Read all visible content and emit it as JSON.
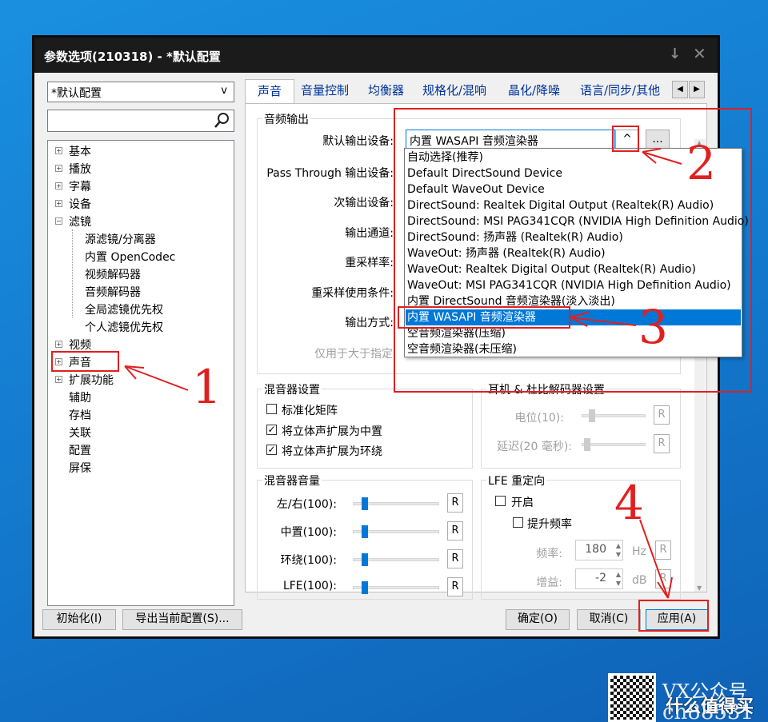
{
  "window": {
    "title": "参数选项(210318) - *默认配置"
  },
  "profile": {
    "selected": "*默认配置",
    "search_placeholder": ""
  },
  "tree": [
    {
      "label": "基本",
      "expand": "+"
    },
    {
      "label": "播放",
      "expand": "+"
    },
    {
      "label": "字幕",
      "expand": "+"
    },
    {
      "label": "设备",
      "expand": "+"
    },
    {
      "label": "滤镜",
      "expand": "−"
    },
    {
      "label": "源滤镜/分离器"
    },
    {
      "label": "内置 OpenCodec"
    },
    {
      "label": "视频解码器"
    },
    {
      "label": "音频解码器"
    },
    {
      "label": "全局滤镜优先权"
    },
    {
      "label": "个人滤镜优先权"
    },
    {
      "label": "视频",
      "expand": "+"
    },
    {
      "label": "声音",
      "expand": "+"
    },
    {
      "label": "扩展功能",
      "expand": "+"
    },
    {
      "label": "辅助"
    },
    {
      "label": "存档"
    },
    {
      "label": "关联"
    },
    {
      "label": "配置"
    },
    {
      "label": "屏保"
    }
  ],
  "tabs": [
    "声音",
    "音量控制",
    "均衡器",
    "规格化/混响",
    "晶化/降噪",
    "语言/同步/其他"
  ],
  "audio_output": {
    "group_title": "音频输出",
    "default_device_label": "默认输出设备:",
    "default_device_value": "内置 WASAPI 音频渲染器",
    "passthrough_label": "Pass Through 输出设备:",
    "secondary_label": "次输出设备:",
    "channels_label": "输出通道:",
    "resample_label": "重采样率:",
    "resample_cond_label": "重采样使用条件:",
    "output_mode_label": "输出方式:",
    "only_for_label": "仅用于大于指定",
    "ellipsis_button": "...",
    "combo_arrow": "^"
  },
  "dropdown_options": [
    "自动选择(推荐)",
    "Default DirectSound Device",
    "Default WaveOut Device",
    "DirectSound: Realtek Digital Output (Realtek(R) Audio)",
    "DirectSound: MSI PAG341CQR (NVIDIA High Definition Audio)",
    "DirectSound: 扬声器 (Realtek(R) Audio)",
    "WaveOut: 扬声器 (Realtek(R) Audio)",
    "WaveOut: Realtek Digital Output (Realtek(R) Audio)",
    "WaveOut: MSI PAG341CQR (NVIDIA High Definition Audio)",
    "内置 DirectSound 音频渲染器(淡入淡出)",
    "内置 WASAPI 音频渲染器",
    "空音频渲染器(压缩)",
    "空音频渲染器(未压缩)"
  ],
  "dropdown_selected_index": 10,
  "mixer": {
    "group_title": "混音器设置",
    "standard_matrix": "标准化矩阵",
    "standard_matrix_checked": false,
    "expand_center": "将立体声扩展为中置",
    "expand_center_checked": true,
    "expand_surround": "将立体声扩展为环绕",
    "expand_surround_checked": true
  },
  "headphone": {
    "group_title": "耳机 & 杜比解码器设置",
    "level_label": "电位(10):",
    "delay_label": "延迟(20 毫秒):",
    "r": "R"
  },
  "mixer_volume": {
    "group_title": "混音器音量",
    "rows": [
      {
        "label": "左/右(100):",
        "level": 0.1
      },
      {
        "label": "中置(100):",
        "level": 0.1
      },
      {
        "label": "环绕(100):",
        "level": 0.1
      },
      {
        "label": "LFE(100):",
        "level": 0.1
      }
    ],
    "r": "R"
  },
  "lfe": {
    "group_title": "LFE 重定向",
    "enable": "开启",
    "enable_checked": false,
    "boost": "提升频率",
    "boost_checked": false,
    "freq_label": "频率:",
    "freq_value": "180",
    "freq_unit": "Hz",
    "gain_label": "增益:",
    "gain_value": "-2",
    "gain_unit": "dB",
    "r": "R"
  },
  "buttons": {
    "init": "初始化(I)",
    "export": "导出当前配置(S)...",
    "ok": "确定(O)",
    "cancel": "取消(C)",
    "apply": "应用(A)"
  },
  "annotations": [
    "1",
    "2",
    "3",
    "4"
  ],
  "watermark": {
    "line1": "VX公众号",
    "line2": "ch88531",
    "line3": "什么值得买"
  },
  "colors": {
    "accent": "#0078d7",
    "annotation": "#e02020",
    "titlebar": "#1b1b1b"
  }
}
